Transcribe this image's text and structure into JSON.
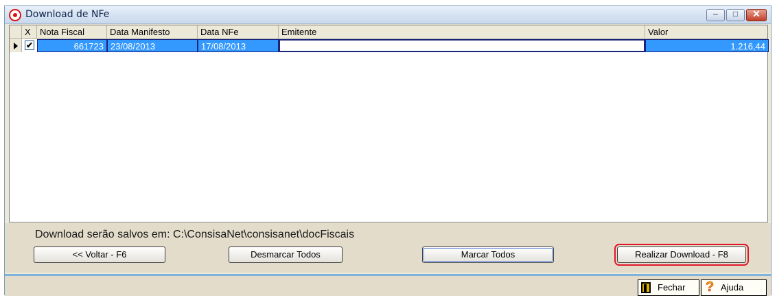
{
  "window": {
    "title": "Download de NFe",
    "controls": {
      "minimize": "‒",
      "maximize": "□",
      "close": "✕"
    }
  },
  "grid": {
    "columns": [
      "X",
      "Nota Fiscal",
      "Data Manifesto",
      "Data NFe",
      "Emitente",
      "Valor"
    ],
    "rows": [
      {
        "checked": "✔",
        "nota_fiscal": "661723",
        "data_manifesto": "23/08/2013",
        "data_nfe": "17/08/2013",
        "emitente": "",
        "valor": "1.216,44"
      }
    ]
  },
  "footer": {
    "path_label": "Download serão salvos em: C:\\ConsisaNet\\consisanet\\docFiscais",
    "buttons": {
      "voltar": "<< Voltar - F6",
      "desmarcar": "Desmarcar Todos",
      "marcar": "Marcar Todos",
      "realizar": "Realizar Download - F8"
    }
  },
  "statusbar": {
    "fechar": "Fechar",
    "ajuda": "Ajuda"
  },
  "colors": {
    "selection": "#3399ff",
    "highlight_outline": "#e2162a",
    "panel": "#e4dccb"
  }
}
